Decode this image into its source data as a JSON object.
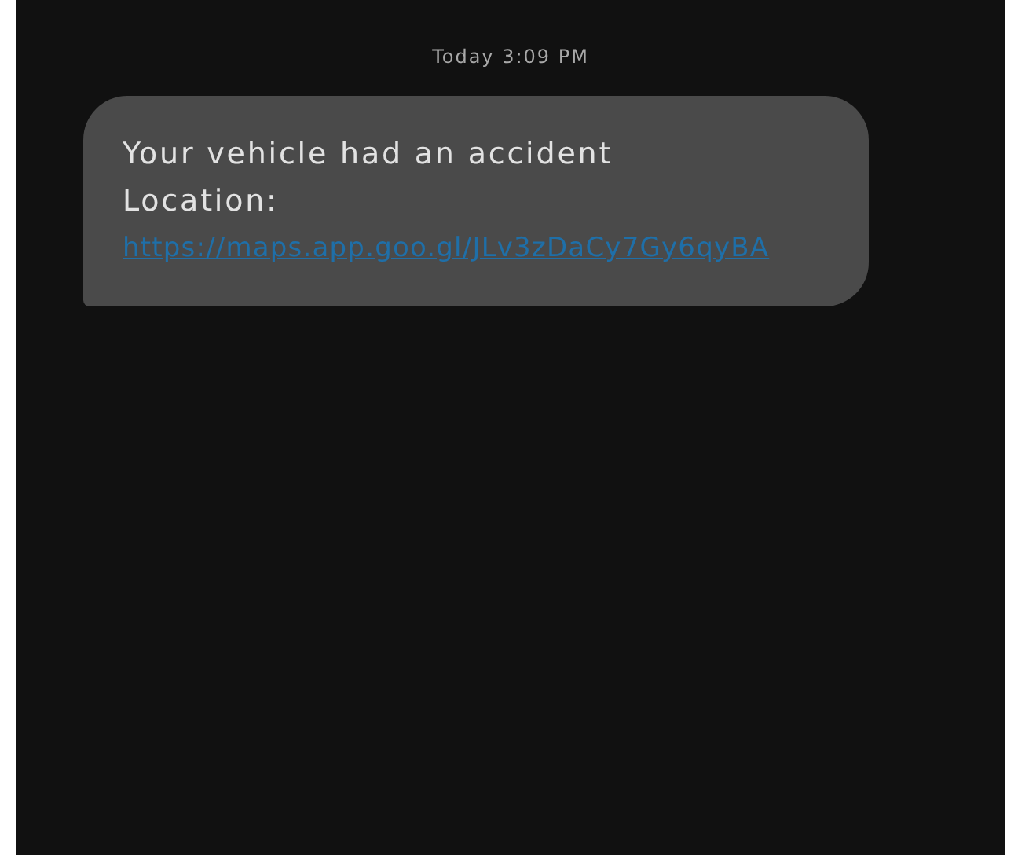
{
  "timestamp": "Today 3:09 PM",
  "messages": [
    {
      "text": "Your vehicle had an accident\nLocation:",
      "link": "https://maps.app.goo.gl/JLv3zDaCy7Gy6qyBA"
    }
  ]
}
